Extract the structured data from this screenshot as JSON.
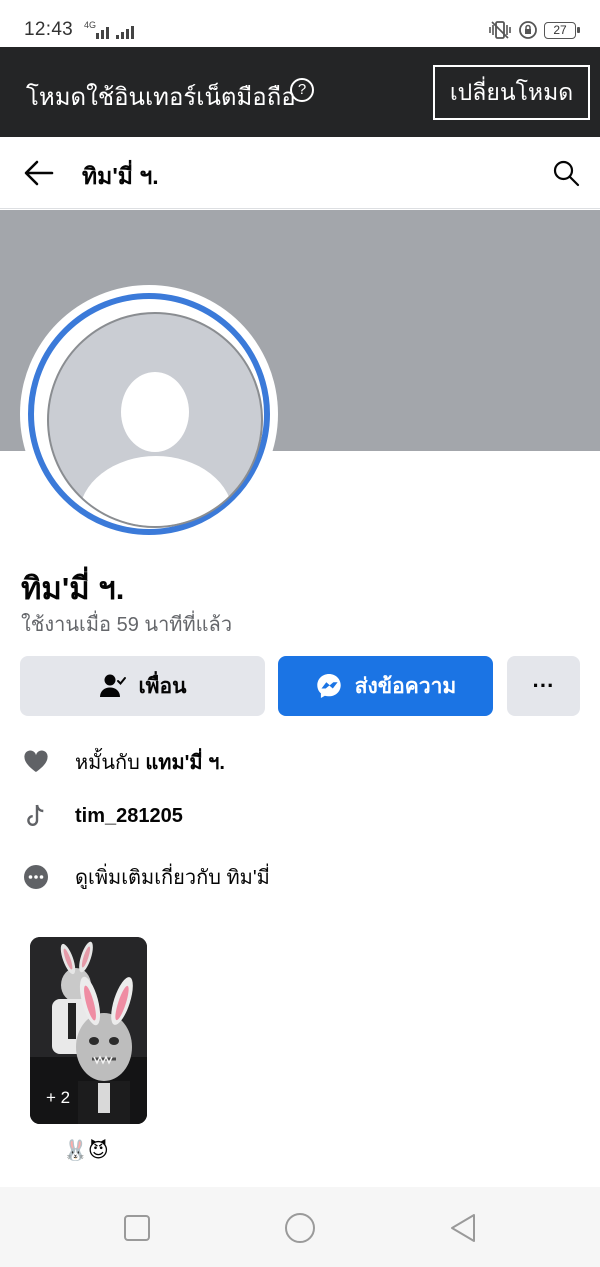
{
  "status_bar": {
    "time": "12:43",
    "network": "4G",
    "battery": "27"
  },
  "data_mode_banner": {
    "text": "โหมดใช้อินเทอร์เน็ตมือถือ",
    "help_icon": "question-circle-icon",
    "switch_button": "เปลี่ยนโหมด"
  },
  "header": {
    "title": "ทิม'มี่ ฯ.",
    "back_icon": "arrow-left-icon",
    "search_icon": "search-icon"
  },
  "profile": {
    "name": "ทิม'มี่ ฯ.",
    "last_active": "ใช้งานเมื่อ 59 นาทีที่แล้ว"
  },
  "actions": {
    "friends_label": "เพื่อน",
    "message_label": "ส่งข้อความ",
    "more_label": "···"
  },
  "intro": {
    "relationship_prefix": "หมั้นกับ",
    "relationship_partner": "แทม'มี่ ฯ.",
    "tiktok": "tim_281205",
    "see_more": "ดูเพิ่มเติมเกี่ยวกับ ทิม'มี่"
  },
  "featured": {
    "count": "+ 2",
    "caption": "🐰😈"
  },
  "colors": {
    "banner_bg": "#242526",
    "cover": "#a3a6ab",
    "accent": "#1b74e4",
    "ring": "#3b7ad9",
    "button_gray": "#e4e6eb",
    "secondary_text": "#65676b"
  }
}
